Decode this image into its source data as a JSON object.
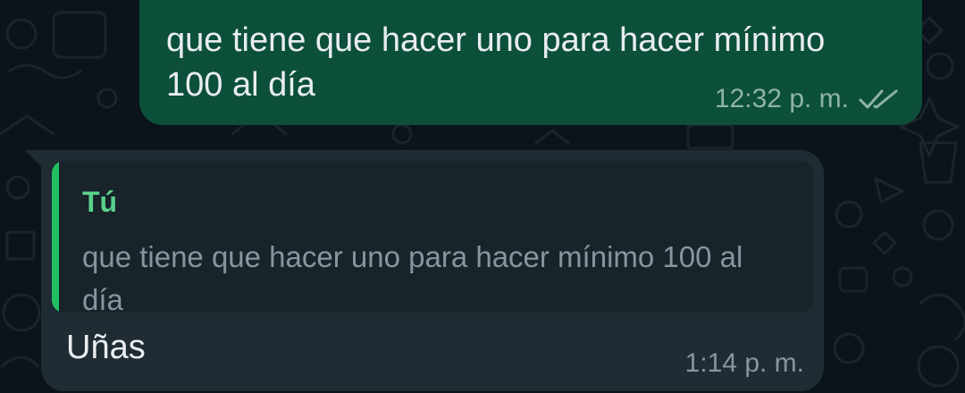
{
  "chat": {
    "outgoing": {
      "text": "que tiene que hacer uno para hacer mínimo 100 al día",
      "time": "12:32 p. m.",
      "status_icon": "double-check-icon"
    },
    "incoming": {
      "quote": {
        "author": "Tú",
        "text": "que tiene que hacer uno para hacer mínimo 100 al día"
      },
      "text": "Uñas",
      "time": "1:14 p. m."
    }
  },
  "colors": {
    "background": "#0b141a",
    "outgoing_bubble": "#0c4f3a",
    "incoming_bubble": "#1f2c33",
    "quote_accent": "#21c063",
    "quote_author": "#59d28a"
  }
}
